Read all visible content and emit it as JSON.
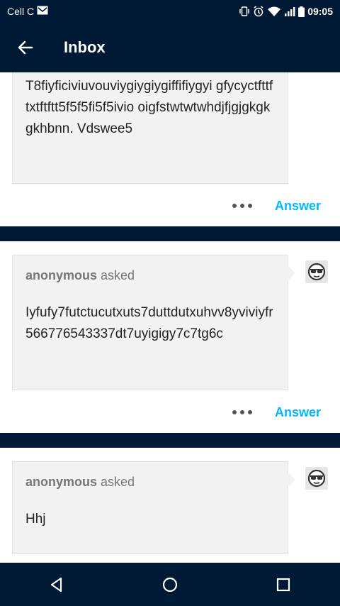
{
  "status": {
    "carrier": "Cell C",
    "time": "09:05"
  },
  "header": {
    "title": "Inbox"
  },
  "posts": [
    {
      "question": "T8fiyficiviuvouviygiygiygiffifiygyi gfycyctfttftxtftftt5f5f5fi5f5ivio oigfstwtwtwhdjfjgjgkgkgkhbnn. Vdswee5",
      "answer_label": "Answer"
    },
    {
      "asker": "anonymous",
      "asked_word": "asked",
      "question": "Iyfufy7futctucutxuts7duttdutxuhvv8yviviyfr566776543337dt7uyigigy7c7tg6c",
      "answer_label": "Answer"
    },
    {
      "asker": "anonymous",
      "asked_word": "asked",
      "question": "Hhj"
    }
  ],
  "icons": {
    "back": "arrow-left-icon",
    "more": "more-dots-icon",
    "avatar": "sunglasses-face-icon",
    "nav_back": "triangle-back-icon",
    "nav_home": "circle-home-icon",
    "nav_recents": "square-recents-icon"
  },
  "colors": {
    "bar": "#001935",
    "accent": "#00b8ff",
    "bubble": "#f2f2f2"
  }
}
